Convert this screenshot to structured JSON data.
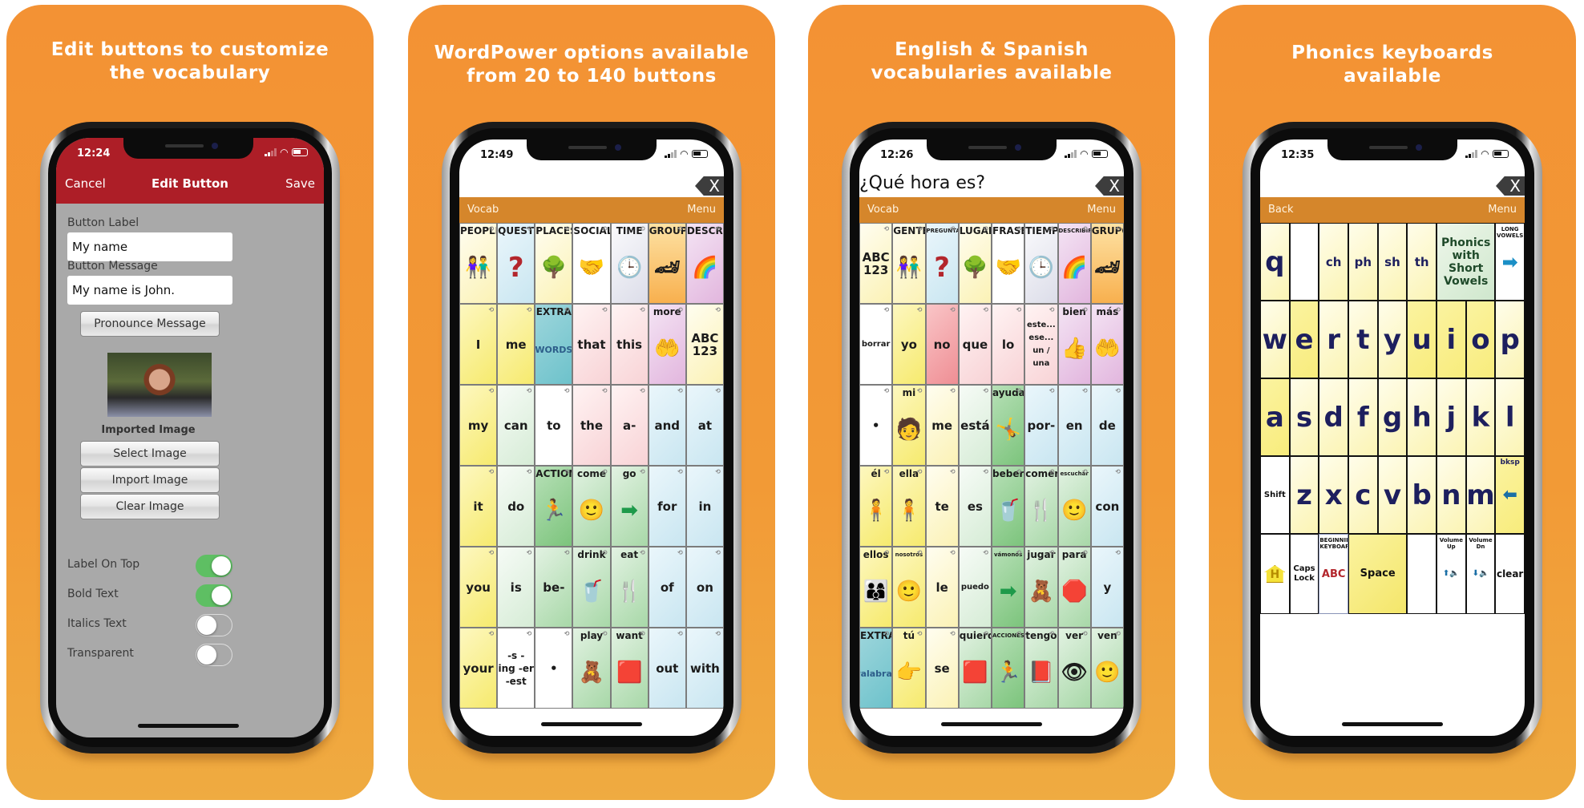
{
  "colors": {
    "panel_orange": "#f39234",
    "edit_nav_red": "#ad1e27",
    "vocab_bar_orange": "#d5862b",
    "toggle_green": "#5ebf63",
    "key_text_navy": "#1d1f5e"
  },
  "panels": [
    {
      "title_line1": "Edit buttons to customize",
      "title_line2": "the vocabulary",
      "status_time": "12:24",
      "nav": {
        "cancel": "Cancel",
        "title": "Edit Button",
        "save": "Save"
      },
      "form": {
        "button_label_label": "Button Label",
        "button_label_value": "My name",
        "button_message_label": "Button Message",
        "button_message_value": "My name is John.",
        "pronounce_button": "Pronounce Message",
        "image_caption": "Imported Image",
        "select_image_button": "Select Image",
        "import_image_button": "Import Image",
        "clear_image_button": "Clear Image",
        "toggles": [
          {
            "label": "Label On Top",
            "on": true
          },
          {
            "label": "Bold Text",
            "on": true
          },
          {
            "label": "Italics Text",
            "on": false
          },
          {
            "label": "Transparent",
            "on": false
          }
        ]
      }
    },
    {
      "title_line1": "WordPower options available",
      "title_line2": "from 20 to 140 buttons",
      "status_time": "12:49",
      "message": "",
      "clear_label": "X",
      "left_button": "Vocab",
      "right_button": "Menu",
      "grid": [
        [
          {
            "top": "PEOPLE",
            "icon": "👫",
            "bg": "c-ltyellow",
            "icon_name": "people-icon"
          },
          {
            "top": "QUESTN",
            "icon": "?",
            "bg": "c-blue",
            "icon_name": "question-icon"
          },
          {
            "top": "PLACES",
            "icon": "🌳",
            "bg": "c-ltyellow",
            "icon_name": "park-icon"
          },
          {
            "top": "SOCIAL",
            "icon": "🤝",
            "bg": "c-white",
            "icon_name": "handshake-icon"
          },
          {
            "top": "TIME",
            "icon": "🕒",
            "bg": "c-lavender",
            "icon_name": "clock-icon"
          },
          {
            "top": "GROUPS",
            "icon": "🏎",
            "bg": "c-orange",
            "icon_name": "toys-icon"
          },
          {
            "top": "DESCRB",
            "icon": "🌈",
            "bg": "c-violet",
            "icon_name": "rainbow-icon"
          }
        ],
        [
          {
            "word": "I",
            "bg": "c-yellow"
          },
          {
            "word": "me",
            "bg": "c-yellow"
          },
          {
            "top": "EXTRA",
            "word": "WORDS",
            "bg": "c-teal"
          },
          {
            "word": "that",
            "bg": "c-pink"
          },
          {
            "word": "this",
            "bg": "c-pink"
          },
          {
            "top": "more",
            "icon": "🤲",
            "bg": "c-violet",
            "icon_name": "more-sign-icon"
          },
          {
            "word": "ABC 123",
            "bg": "c-ltyellow"
          }
        ],
        [
          {
            "word": "my",
            "bg": "c-yellow"
          },
          {
            "word": "can",
            "bg": "c-ltgreen"
          },
          {
            "word": "to",
            "bg": "c-white"
          },
          {
            "word": "the",
            "bg": "c-pink"
          },
          {
            "word": "a-",
            "bg": "c-pink"
          },
          {
            "word": "and",
            "bg": "c-blue"
          },
          {
            "word": "at",
            "bg": "c-blue"
          }
        ],
        [
          {
            "word": "it",
            "bg": "c-yellow"
          },
          {
            "word": "do",
            "bg": "c-ltgreen"
          },
          {
            "top": "ACTIONS",
            "icon": "🏃",
            "bg": "c-dkgreen",
            "icon_name": "running-icon"
          },
          {
            "top": "come",
            "icon": "🙂",
            "bg": "c-green",
            "icon_name": "come-figure-icon"
          },
          {
            "top": "go",
            "icon": "➡",
            "bg": "c-green",
            "icon_name": "arrow-right-icon"
          },
          {
            "word": "for",
            "bg": "c-blue"
          },
          {
            "word": "in",
            "bg": "c-blue"
          }
        ],
        [
          {
            "word": "you",
            "bg": "c-yellow"
          },
          {
            "word": "is",
            "bg": "c-ltgreen"
          },
          {
            "word": "be-",
            "bg": "c-green"
          },
          {
            "top": "drink",
            "icon": "🥤",
            "bg": "c-green",
            "icon_name": "drink-icon"
          },
          {
            "top": "eat",
            "icon": "🍴",
            "bg": "c-green",
            "icon_name": "eat-icon"
          },
          {
            "word": "of",
            "bg": "c-blue"
          },
          {
            "word": "on",
            "bg": "c-blue"
          }
        ],
        [
          {
            "word": "your",
            "bg": "c-yellow"
          },
          {
            "word": "-s - ing -er -est",
            "bg": "c-white"
          },
          {
            "word": "•",
            "bg": "c-white"
          },
          {
            "top": "play",
            "icon": "🧸",
            "bg": "c-green",
            "icon_name": "play-icon"
          },
          {
            "top": "want",
            "icon": "🟥",
            "bg": "c-green",
            "icon_name": "want-icon"
          },
          {
            "word": "out",
            "bg": "c-blue"
          },
          {
            "word": "with",
            "bg": "c-blue"
          }
        ]
      ]
    },
    {
      "title_line1": "English & Spanish",
      "title_line2": "vocabularies available",
      "status_time": "12:26",
      "message": "¿Qué hora es?",
      "clear_label": "X",
      "left_button": "Vocab",
      "right_button": "Menu",
      "grid": [
        [
          {
            "word": "ABC 123",
            "bg": "c-ltyellow"
          },
          {
            "top": "GENTE",
            "icon": "👫",
            "bg": "c-ltyellow",
            "icon_name": "people-icon"
          },
          {
            "top": "PREGUNTAS",
            "tiny": true,
            "icon": "?",
            "bg": "c-blue",
            "icon_name": "question-icon"
          },
          {
            "top": "LUGARES",
            "icon": "🌳",
            "bg": "c-ltyellow",
            "icon_name": "park-icon"
          },
          {
            "top": "FRASES",
            "icon": "🤝",
            "bg": "c-white",
            "icon_name": "handshake-icon"
          },
          {
            "top": "TIEMPO",
            "icon": "🕒",
            "bg": "c-lavender",
            "icon_name": "clock-icon"
          },
          {
            "top": "DESCRIBIR",
            "tiny": true,
            "icon": "🌈",
            "bg": "c-violet",
            "icon_name": "rainbow-icon"
          },
          {
            "top": "GRUPOS",
            "icon": "🏎",
            "bg": "c-orange",
            "icon_name": "toys-icon"
          }
        ],
        [
          {
            "word": "borrar",
            "small": true,
            "bg": "c-white"
          },
          {
            "word": "yo",
            "bg": "c-yellow"
          },
          {
            "word": "no",
            "bg": "c-red"
          },
          {
            "word": "que",
            "bg": "c-pink"
          },
          {
            "word": "lo",
            "bg": "c-pink"
          },
          {
            "word": "este... ese... un / una",
            "small": true,
            "bg": "c-pink"
          },
          {
            "top": "bien",
            "icon": "👍",
            "bg": "c-violet",
            "icon_name": "thumbs-up-icon"
          },
          {
            "top": "más",
            "icon": "🤲",
            "bg": "c-violet",
            "icon_name": "more-sign-icon"
          }
        ],
        [
          {
            "word": "•",
            "bg": "c-white"
          },
          {
            "top": "mi",
            "icon": "🧑",
            "bg": "c-yellow",
            "icon_name": "my-figure-icon"
          },
          {
            "word": "me",
            "bg": "c-ltyellow"
          },
          {
            "word": "está",
            "bg": "c-ltgreen"
          },
          {
            "top": "ayuda",
            "icon": "🤸",
            "bg": "c-dkgreen",
            "icon_name": "help-icon"
          },
          {
            "word": "por-",
            "bg": "c-blue"
          },
          {
            "word": "en",
            "bg": "c-blue"
          },
          {
            "word": "de",
            "bg": "c-blue"
          }
        ],
        [
          {
            "top": "él",
            "icon": "🧍",
            "bg": "c-yellow",
            "icon_name": "boy-icon"
          },
          {
            "top": "ella",
            "icon": "🧍",
            "bg": "c-yellow",
            "icon_name": "girl-icon"
          },
          {
            "word": "te",
            "bg": "c-ltyellow"
          },
          {
            "word": "es",
            "bg": "c-ltgreen"
          },
          {
            "top": "beber",
            "icon": "🥤",
            "bg": "c-dkgreen",
            "icon_name": "drink-icon"
          },
          {
            "top": "comer",
            "icon": "🍴",
            "bg": "c-green",
            "icon_name": "eat-icon"
          },
          {
            "top": "escuchar",
            "tiny": true,
            "icon": "🙂",
            "bg": "c-green",
            "icon_name": "listen-icon"
          },
          {
            "word": "con",
            "bg": "c-blue"
          }
        ],
        [
          {
            "top": "ellos",
            "icon": "👨‍👩‍👦",
            "bg": "c-yellow",
            "icon_name": "they-icon"
          },
          {
            "top": "nosotros",
            "tiny": true,
            "icon": "🙂",
            "bg": "c-yellow",
            "icon_name": "we-icon"
          },
          {
            "word": "le",
            "bg": "c-ltyellow"
          },
          {
            "word": "puedo",
            "small": true,
            "bg": "c-ltgreen"
          },
          {
            "top": "vámonos",
            "tiny": true,
            "icon": "➡",
            "bg": "c-dkgreen",
            "icon_name": "arrow-right-icon"
          },
          {
            "top": "jugar",
            "icon": "🧸",
            "bg": "c-green",
            "icon_name": "play-icon"
          },
          {
            "top": "para",
            "icon": "🛑",
            "bg": "c-green",
            "icon_name": "stop-sign-icon"
          },
          {
            "word": "y",
            "bg": "c-blue"
          }
        ],
        [
          {
            "top": "EXTRA",
            "word": "Palabras",
            "small": true,
            "bg": "c-teal"
          },
          {
            "top": "tú",
            "icon": "👉",
            "bg": "c-yellow",
            "icon_name": "you-icon"
          },
          {
            "word": "se",
            "bg": "c-ltyellow"
          },
          {
            "top": "quiero",
            "icon": "🟥",
            "bg": "c-green",
            "icon_name": "want-icon"
          },
          {
            "top": "ACCIONES",
            "tiny": true,
            "icon": "🏃",
            "bg": "c-dkgreen",
            "icon_name": "running-icon"
          },
          {
            "top": "tengo",
            "icon": "📕",
            "bg": "c-green",
            "icon_name": "have-icon"
          },
          {
            "top": "ver",
            "icon": "👁",
            "bg": "c-green",
            "icon_name": "eye-icon"
          },
          {
            "top": "ven",
            "icon": "🙂",
            "bg": "c-green",
            "icon_name": "come-figure-icon"
          }
        ]
      ]
    },
    {
      "title_line1": "Phonics keyboards",
      "title_line2": "available",
      "status_time": "12:35",
      "message": "",
      "clear_label": "X",
      "left_button": "Back",
      "right_button": "Menu",
      "keyboard": {
        "row1": [
          "q",
          "",
          "ch",
          "ph",
          "sh",
          "th"
        ],
        "phonics_label": "Phonics with Short Vowels",
        "long_vowels_label": "LONG VOWELS",
        "row2": [
          "w",
          "e",
          "r",
          "t",
          "y",
          "u",
          "i",
          "o",
          "p"
        ],
        "row3": [
          "a",
          "s",
          "d",
          "f",
          "g",
          "h",
          "j",
          "k",
          "l"
        ],
        "shift_label": "Shift",
        "row4": [
          "z",
          "x",
          "c",
          "v",
          "b",
          "n",
          "m"
        ],
        "bksp_label": "bksp",
        "home_label": "H",
        "caps_label": "Caps Lock",
        "beginning_kb_label": "BEGINNING KEYBOARD",
        "abc_label": "ABC",
        "space_label": "Space",
        "vol_up_label": "Volume Up",
        "vol_dn_label": "Volume Dn",
        "clear_label": "clear"
      }
    }
  ]
}
